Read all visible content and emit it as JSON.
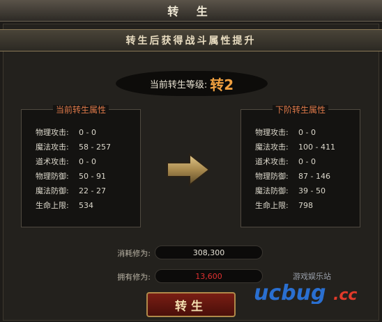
{
  "window": {
    "title": "转 生"
  },
  "header": {
    "subtitle": "转生后获得战斗属性提升"
  },
  "level": {
    "label": "当前转生等级:",
    "value": "转2"
  },
  "current": {
    "title": "当前转生属性",
    "rows": [
      {
        "label": "物理攻击:",
        "value": "0 - 0"
      },
      {
        "label": "魔法攻击:",
        "value": "58 - 257"
      },
      {
        "label": "道术攻击:",
        "value": "0 - 0"
      },
      {
        "label": "物理防御:",
        "value": "50 - 91"
      },
      {
        "label": "魔法防御:",
        "value": "22 - 27"
      },
      {
        "label": "生命上限:",
        "value": "534"
      }
    ]
  },
  "next": {
    "title": "下阶转生属性",
    "rows": [
      {
        "label": "物理攻击:",
        "value": "0 - 0"
      },
      {
        "label": "魔法攻击:",
        "value": "100 - 411"
      },
      {
        "label": "道术攻击:",
        "value": "0 - 0"
      },
      {
        "label": "物理防御:",
        "value": "87 - 146"
      },
      {
        "label": "魔法防御:",
        "value": "39 - 50"
      },
      {
        "label": "生命上限:",
        "value": "798"
      }
    ]
  },
  "cost": {
    "consume_label": "消耗修为:",
    "consume_value": "308,300",
    "own_label": "拥有修为:",
    "own_value": "13,600"
  },
  "actions": {
    "reborn_label": "转生"
  },
  "watermark": {
    "text": "ucbug.cc",
    "subtext": "游戏娱乐站"
  },
  "colors": {
    "accent": "#e07a4a",
    "level_value": "#f0a040",
    "own_value": "#e03030",
    "consume_value": "#e8e4d8",
    "watermark_blue": "#2a6fd0",
    "watermark_red": "#e23a2a"
  },
  "icons": {
    "arrow": "right-arrow-icon"
  }
}
